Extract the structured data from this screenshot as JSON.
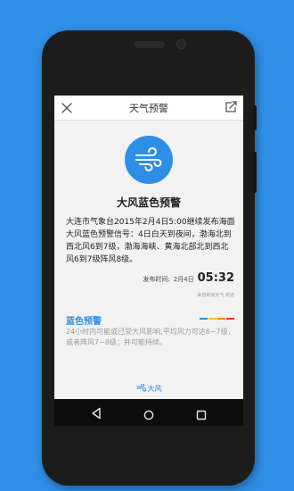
{
  "header": {
    "title": "天气预警",
    "close_icon": "close-icon",
    "share_icon": "share-icon"
  },
  "alert": {
    "icon": "wind-icon",
    "title": "大风蓝色预警",
    "body": "大连市气象台2015年2月4日5:00继续发布海面大风蓝色预警信号：4日白天到夜间，渤海北到西北风6到7级，渤海海峡、黄海北部北到西北风6到7级阵风8级。",
    "publish_label": "发布时间:",
    "publish_date": "2月4日",
    "publish_time": "05:32",
    "source": "来自新浪天气 频道"
  },
  "level": {
    "title": "蓝色预警",
    "colors": [
      "#2d8ee6",
      "#f2c200",
      "#f28a00",
      "#e03030"
    ],
    "description": "24小时内可能或已受大风影响,平均风力可达6~7级，或者阵风7~8级；并可能持续。"
  },
  "footer": {
    "link_label": "大风",
    "link_icon": "wind-icon"
  },
  "navbar": {
    "back_icon": "back-icon",
    "home_icon": "home-icon",
    "recents_icon": "recents-icon"
  },
  "colors": {
    "background": "#2f8fe6",
    "accent": "#2d8ee6",
    "phone_body": "#1c1c1c",
    "screen_bg": "#f2f2f2"
  }
}
